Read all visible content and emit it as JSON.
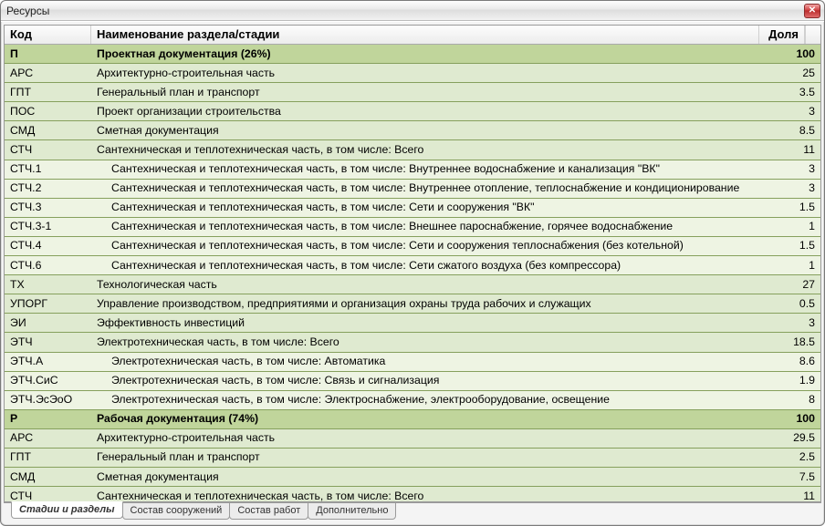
{
  "window": {
    "title": "Ресурсы"
  },
  "columns": {
    "code": "Код",
    "name": "Наименование раздела/стадии",
    "share": "Доля"
  },
  "rows": [
    {
      "type": "section",
      "code": "П",
      "name": "Проектная документация (26%)",
      "share": "100"
    },
    {
      "type": "lvl0",
      "code": "АРС",
      "name": "Архитектурно-строительная часть",
      "share": "25"
    },
    {
      "type": "lvl0",
      "code": "ГПТ",
      "name": "Генеральный план и транспорт",
      "share": "3.5"
    },
    {
      "type": "lvl0",
      "code": "ПОС",
      "name": "Проект организации строительства",
      "share": "3"
    },
    {
      "type": "lvl0",
      "code": "СМД",
      "name": "Сметная документация",
      "share": "8.5"
    },
    {
      "type": "lvl0",
      "code": "СТЧ",
      "name": "Сантехническая и теплотехническая часть, в том числе: Всего",
      "share": "11"
    },
    {
      "type": "lvl1",
      "code": "СТЧ.1",
      "name": "Сантехническая и теплотехническая часть, в том числе: Внутреннее водоснабжение и канализация \"ВК\"",
      "share": "3"
    },
    {
      "type": "lvl1",
      "code": "СТЧ.2",
      "name": "Сантехническая и теплотехническая часть, в том числе: Внутреннее отопление, теплоснабжение и кондиционирование",
      "share": "3"
    },
    {
      "type": "lvl1",
      "code": "СТЧ.3",
      "name": "Сантехническая и теплотехническая часть, в том числе: Сети и сооружения \"ВК\"",
      "share": "1.5"
    },
    {
      "type": "lvl1",
      "code": "СТЧ.3-1",
      "name": "Сантехническая и теплотехническая часть, в том числе: Внешнее пароснабжение, горячее водоснабжение",
      "share": "1"
    },
    {
      "type": "lvl1",
      "code": "СТЧ.4",
      "name": "Сантехническая и теплотехническая часть, в том числе: Сети и сооружения теплоснабжения (без котельной)",
      "share": "1.5"
    },
    {
      "type": "lvl1",
      "code": "СТЧ.6",
      "name": "Сантехническая и теплотехническая часть, в том числе: Сети сжатого воздуха (без компрессора)",
      "share": "1"
    },
    {
      "type": "lvl0",
      "code": "ТХ",
      "name": "Технологическая часть",
      "share": "27"
    },
    {
      "type": "lvl0",
      "code": "УПОРГ",
      "name": "Управление производством, предприятиями и организация охраны труда рабочих и служащих",
      "share": "0.5"
    },
    {
      "type": "lvl0",
      "code": "ЭИ",
      "name": "Эффективность инвестиций",
      "share": "3"
    },
    {
      "type": "lvl0",
      "code": "ЭТЧ",
      "name": "Электротехническая часть, в том числе: Всего",
      "share": "18.5"
    },
    {
      "type": "lvl1",
      "code": "ЭТЧ.А",
      "name": "Электротехническая часть, в том числе: Автоматика",
      "share": "8.6"
    },
    {
      "type": "lvl1",
      "code": "ЭТЧ.СиС",
      "name": "Электротехническая часть, в том числе: Связь и сигнализация",
      "share": "1.9"
    },
    {
      "type": "lvl1",
      "code": "ЭТЧ.ЭсЭоО",
      "name": "Электротехническая часть, в том числе: Электроснабжение, электрооборудование, освещение",
      "share": "8"
    },
    {
      "type": "section",
      "code": "Р",
      "name": "Рабочая документация (74%)",
      "share": "100"
    },
    {
      "type": "lvl0",
      "code": "АРС",
      "name": "Архитектурно-строительная часть",
      "share": "29.5"
    },
    {
      "type": "lvl0",
      "code": "ГПТ",
      "name": "Генеральный план и транспорт",
      "share": "2.5"
    },
    {
      "type": "lvl0",
      "code": "СМД",
      "name": "Сметная документация",
      "share": "7.5"
    },
    {
      "type": "lvl0",
      "code": "СТЧ",
      "name": "Сантехническая и теплотехническая часть, в том числе: Всего",
      "share": "11"
    }
  ],
  "tabs": [
    {
      "label": "Стадии и разделы",
      "active": true
    },
    {
      "label": "Состав сооружений",
      "active": false
    },
    {
      "label": "Состав работ",
      "active": false
    },
    {
      "label": "Дополнительно",
      "active": false
    }
  ]
}
